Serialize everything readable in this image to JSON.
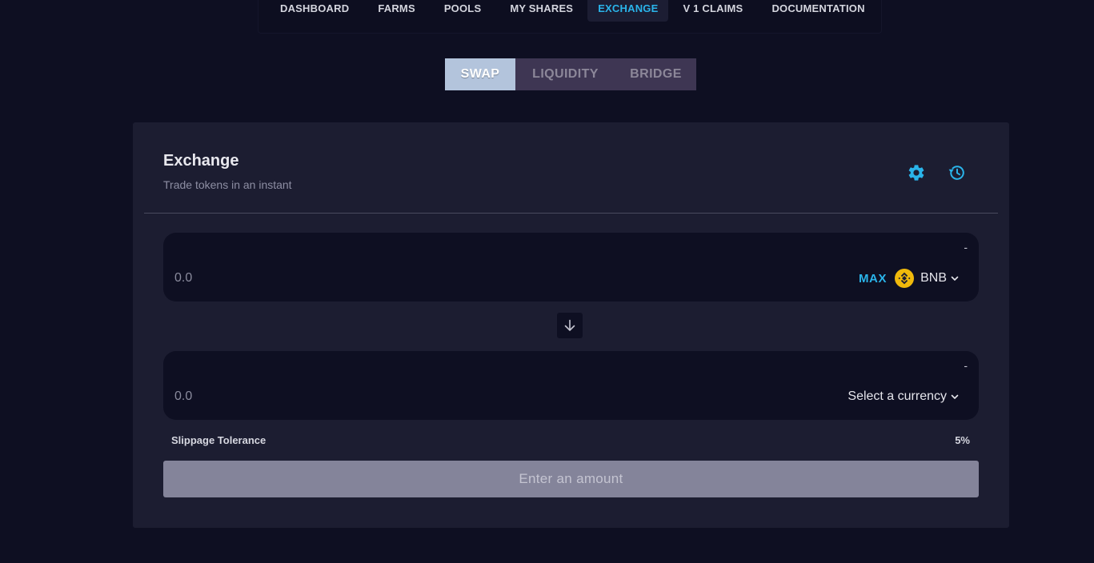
{
  "nav": {
    "items": [
      {
        "label": "DASHBOARD",
        "active": false
      },
      {
        "label": "FARMS",
        "active": false
      },
      {
        "label": "POOLS",
        "active": false
      },
      {
        "label": "MY SHARES",
        "active": false
      },
      {
        "label": "EXCHANGE",
        "active": true
      },
      {
        "label": "V 1 CLAIMS",
        "active": false
      },
      {
        "label": "DOCUMENTATION",
        "active": false
      }
    ]
  },
  "sub_tabs": [
    {
      "label": "SWAP",
      "active": true
    },
    {
      "label": "LIQUIDITY",
      "active": false
    },
    {
      "label": "BRIDGE",
      "active": false
    }
  ],
  "exchange": {
    "title": "Exchange",
    "subtitle": "Trade tokens in an instant",
    "icons": {
      "settings": "gear-icon",
      "history": "history-icon"
    },
    "from": {
      "balance": "-",
      "amount_placeholder": "0.0",
      "max_label": "MAX",
      "token_label": "BNB",
      "token_icon": "bnb-logo-icon"
    },
    "to": {
      "balance": "-",
      "amount_placeholder": "0.0",
      "select_label": "Select a currency"
    },
    "slippage": {
      "label": "Slippage Tolerance",
      "value": "5%"
    },
    "submit_label": "Enter an amount"
  },
  "colors": {
    "background": "#0e0f22",
    "card": "#1c1d31",
    "accent": "#2ab4ea",
    "bnb": "#f0b90b",
    "tab_active": "#b3c4dc",
    "tab_inactive": "#3e3653",
    "button_disabled": "#84849a"
  }
}
